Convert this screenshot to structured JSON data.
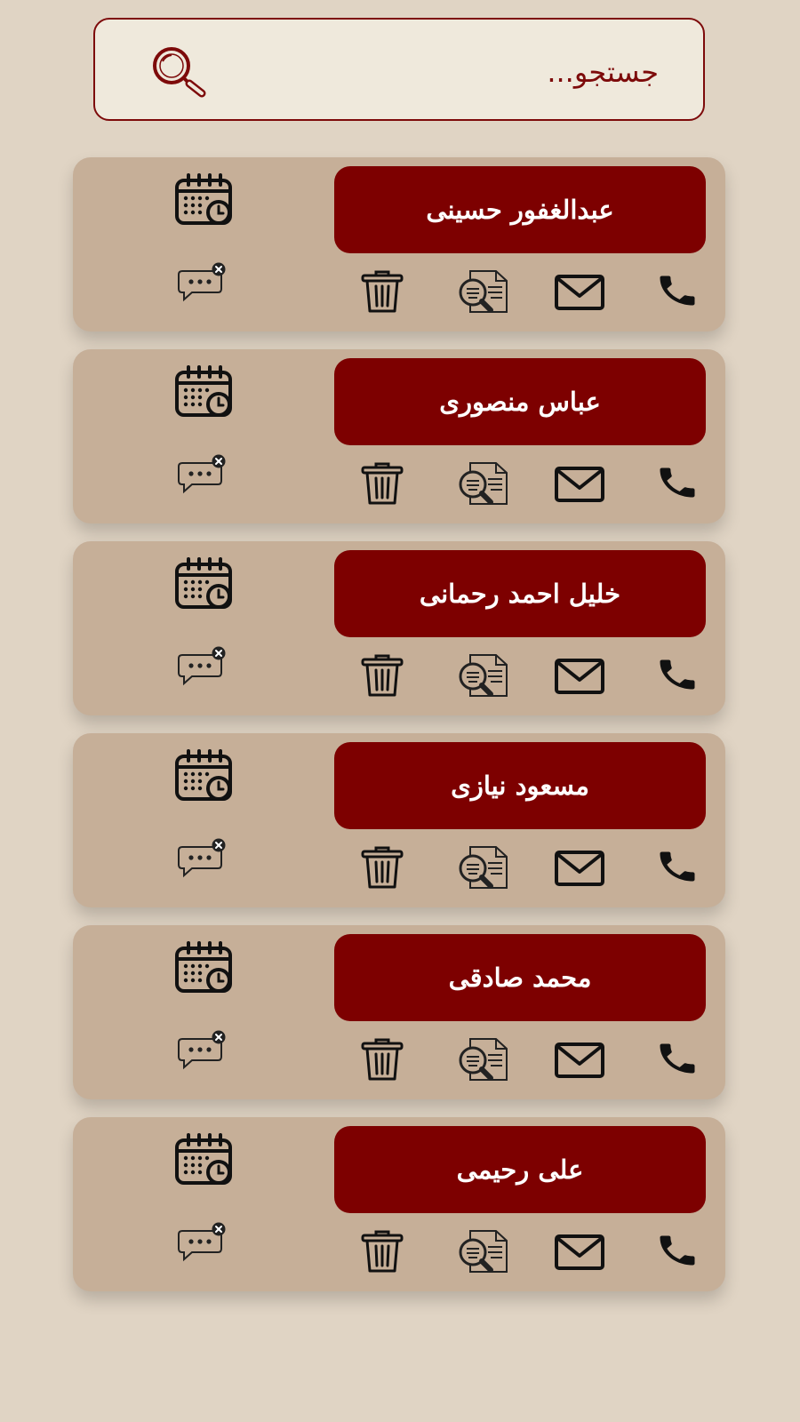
{
  "search": {
    "placeholder": "جستجو..."
  },
  "contacts": [
    {
      "name": "عبدالغفور حسینی"
    },
    {
      "name": "عباس منصوری"
    },
    {
      "name": "خلیل احمد رحمانی"
    },
    {
      "name": "مسعود نیازی"
    },
    {
      "name": "محمد صادقی"
    },
    {
      "name": "علی رحیمی"
    }
  ],
  "actions": [
    "schedule-icon",
    "message-cancel-icon",
    "delete-icon",
    "document-search-icon",
    "email-icon",
    "phone-icon"
  ],
  "colors": {
    "background": "#e0d4c4",
    "card": "#c6af98",
    "accent": "#7d0000",
    "search_bg": "#efe9dc",
    "icon": "#111111"
  }
}
